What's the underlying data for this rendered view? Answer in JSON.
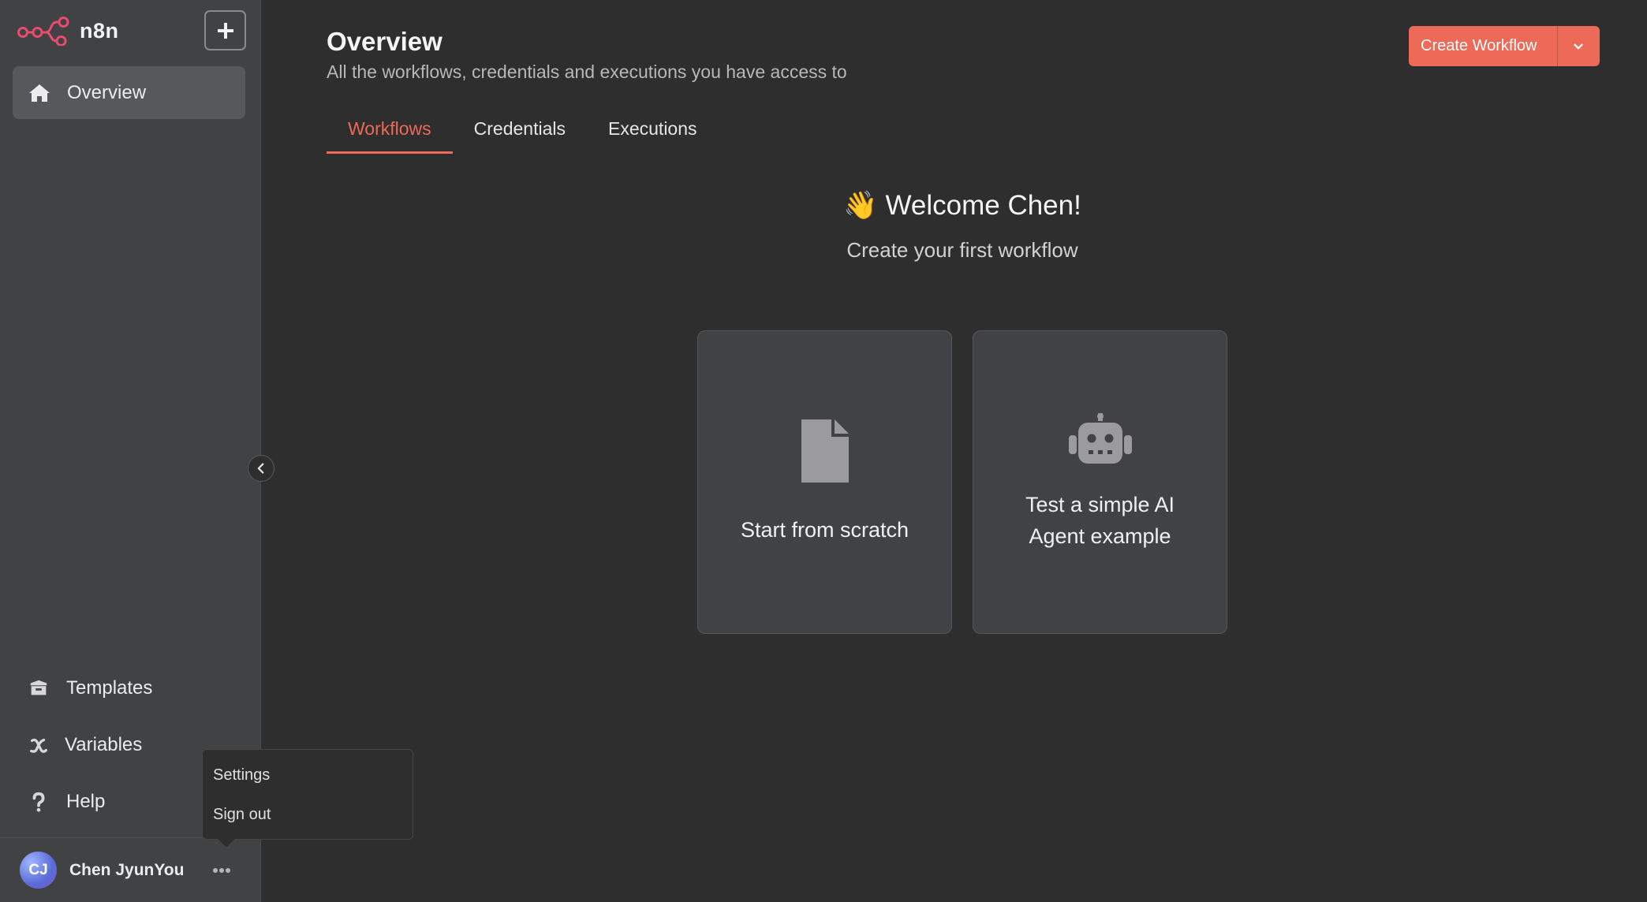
{
  "app": {
    "name": "n8n"
  },
  "sidebar": {
    "add_button_label": "+",
    "overview_label": "Overview",
    "bottom_items": [
      {
        "label": "Templates",
        "icon": "box-icon"
      },
      {
        "label": "Variables",
        "icon": "variable-x-icon"
      },
      {
        "label": "Help",
        "icon": "question-icon"
      }
    ],
    "user": {
      "initials": "CJ",
      "name": "Chen JyunYou"
    }
  },
  "popup_menu": {
    "items": [
      "Settings",
      "Sign out"
    ]
  },
  "header": {
    "title": "Overview",
    "subtitle": "All the workflows, credentials and executions you have access to",
    "create_button_label": "Create Workflow"
  },
  "tabs": [
    {
      "label": "Workflows",
      "active": true
    },
    {
      "label": "Credentials",
      "active": false
    },
    {
      "label": "Executions",
      "active": false
    }
  ],
  "welcome": {
    "emoji": "👋",
    "title": "Welcome Chen!",
    "subtitle": "Create your first workflow"
  },
  "cards": [
    {
      "label": "Start from scratch",
      "icon": "file-icon"
    },
    {
      "label_line1": "Test a simple AI",
      "label_line2": "Agent example",
      "icon": "robot-icon"
    }
  ],
  "colors": {
    "accent": "#ec6a57",
    "sidebar_bg": "#414244",
    "main_bg": "#2e2e2e"
  }
}
